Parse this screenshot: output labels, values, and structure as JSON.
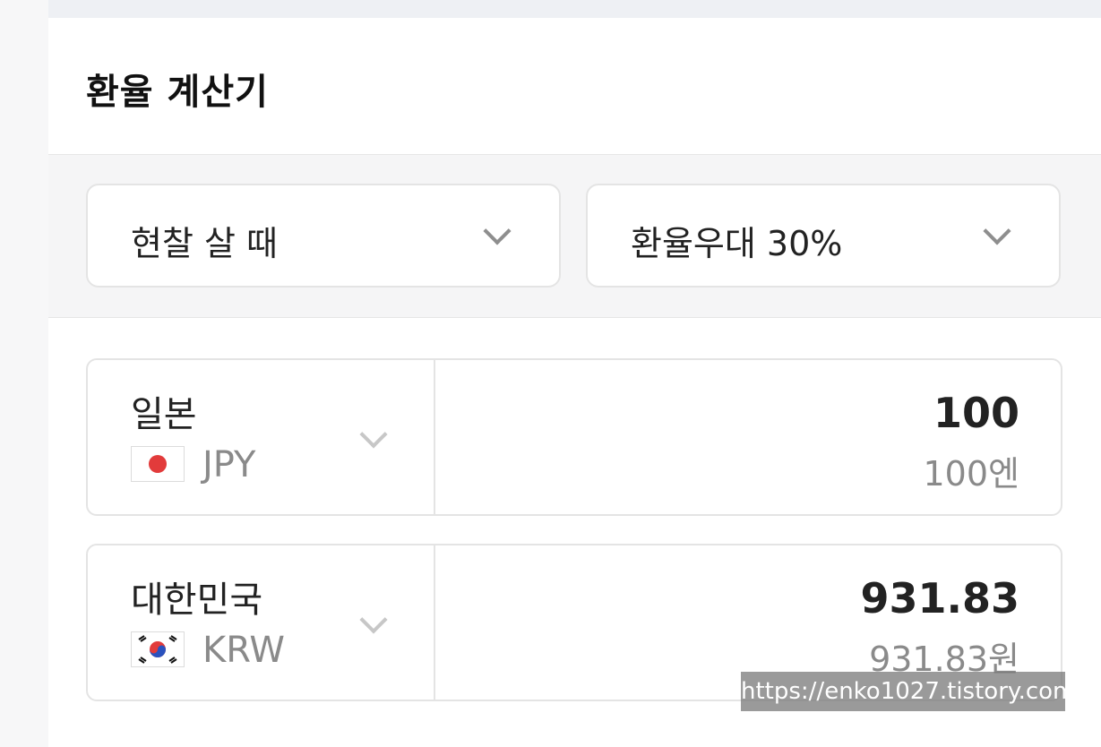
{
  "calculator": {
    "title": "환율 계산기",
    "filters": {
      "rate_type": {
        "selected": "현찰 살 때"
      },
      "preferential": {
        "selected": "환율우대 30%"
      }
    },
    "from": {
      "country": "일본",
      "currency_code": "JPY",
      "amount": "100",
      "amount_text": "100엔",
      "flag_icon": "japan-flag-icon"
    },
    "to": {
      "country": "대한민국",
      "currency_code": "KRW",
      "amount": "931.83",
      "amount_text": "931.83원",
      "flag_icon": "korea-flag-icon"
    }
  },
  "watermark": "https://enko1027.tistory.com",
  "colors": {
    "accent_red": "#e23b3b",
    "korea_blue": "#2a52be",
    "text": "#222222",
    "muted": "#8a8a8a"
  }
}
